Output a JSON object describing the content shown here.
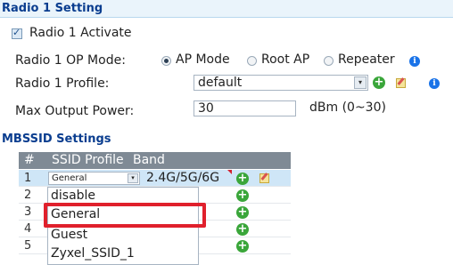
{
  "radio_setting": {
    "title": "Radio 1 Setting",
    "activate_label": "Radio 1 Activate",
    "activate_checked": true,
    "op_mode_label": "Radio 1 OP Mode:",
    "op_modes": [
      "AP Mode",
      "Root AP",
      "Repeater"
    ],
    "op_mode_selected": "AP Mode",
    "profile_label": "Radio 1 Profile:",
    "profile_value": "default",
    "power_label": "Max Output Power:",
    "power_value": "30",
    "power_unit": "dBm (0~30)"
  },
  "mbssid": {
    "title": "MBSSID Settings",
    "columns": [
      "#",
      "SSID Profile",
      "Band"
    ],
    "rows": [
      {
        "num": "1",
        "profile": "General",
        "band": "2.4G/5G/6G"
      },
      {
        "num": "2"
      },
      {
        "num": "3"
      },
      {
        "num": "4"
      },
      {
        "num": "5"
      }
    ],
    "dropdown_options": [
      "disable",
      "General",
      "Guest",
      "Zyxel_SSID_1"
    ],
    "dropdown_highlighted": "General"
  },
  "icons": {
    "info": "i",
    "plus": "+",
    "arrow": "▾"
  },
  "colors": {
    "section_title": "#0a3d8f",
    "selected_row": "#cfe6f7",
    "highlight": "#e0202c",
    "add_icon": "#3aa63a",
    "info_icon": "#1a73e8"
  }
}
